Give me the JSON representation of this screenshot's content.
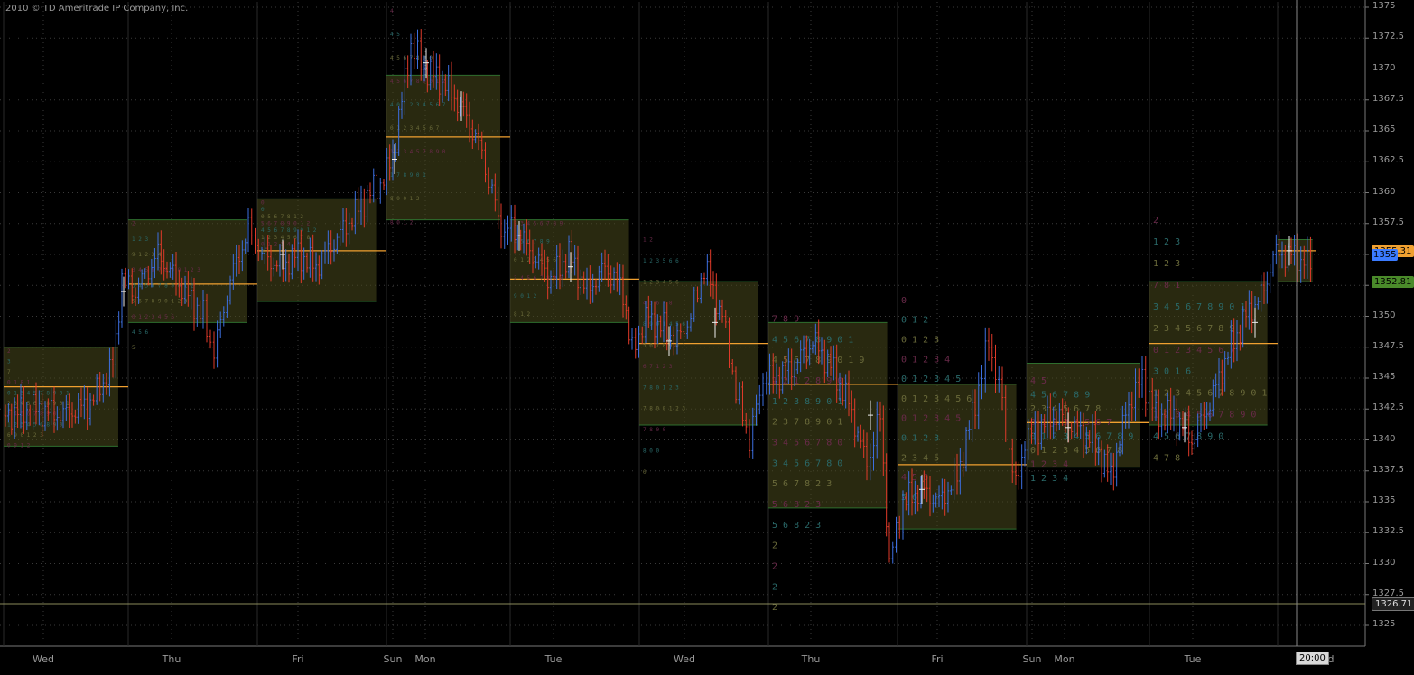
{
  "copyright": "2010 © TD Ameritrade IP Company, Inc.",
  "y_axis": {
    "ticks": [
      "1375",
      "1372.5",
      "1370",
      "1367.5",
      "1365",
      "1362.5",
      "1360",
      "1357.5",
      "1355",
      "1352.5",
      "1350",
      "1347.5",
      "1345",
      "1342.5",
      "1340",
      "1337.5",
      "1335",
      "1332.5",
      "1330",
      "1327.5",
      "1325"
    ]
  },
  "x_axis": {
    "labels": [
      "Wed",
      "Thu",
      "Fri",
      "Sun",
      "Mon",
      "Tue",
      "Wed",
      "Thu",
      "Fri",
      "Sun",
      "Mon",
      "Tue"
    ],
    "time_cursor": "20:00",
    "trailing_label": "d"
  },
  "price_badges": {
    "last": "1355.31",
    "last_short": "1355",
    "level": "1352.81",
    "low_line": "1326.71"
  },
  "colors": {
    "up": "#3d6fe0",
    "down": "#e03a2a",
    "grid": "#3a3a3a",
    "poc": "#f0a030",
    "value_area": "#2e6e2e",
    "profile_fill": "#4a4a1e",
    "badge_last": "#3b7bff",
    "badge_level": "#4a8a2a",
    "text": "#9a9a9a"
  },
  "profiles": [
    {
      "label": "Wed",
      "poc": "1344.5",
      "rows": [
        "2",
        "3",
        "7",
        "0 1 8 1",
        "0 1 3 4 5 7 8 9 0 1",
        "2 3 4 5 6 7 8 9 0 1",
        "3 4 5 6 7 8 9 0",
        "1 2 3 4 5 6 8 9 0",
        "6 9 0 1 2 3",
        "0 9 1 2"
      ]
    },
    {
      "label": "Thu",
      "poc": "1352.5",
      "rows": [
        "2",
        "1 2 3",
        "9 1 2 3 4",
        "3 4 5 6 7 8 9 0 1 2 3",
        "3 4 5 6 7 8 9 0 1 2",
        "5 6 7 8 9 0 1 2 3",
        "0 1 2 3 4 5 6",
        "4 5 6",
        "5"
      ]
    },
    {
      "label": "Fri",
      "poc": "1355.3",
      "rows": [
        "0",
        "0",
        "0 5 6 7 8 1 2",
        "5 6 7 8 9 0 1 2",
        "4 5 6 7 8 9 0 1 2",
        "1 2 3 4 5 6 7 8",
        "0 1 2 3 4",
        "1"
      ]
    },
    {
      "label": "Mon",
      "poc": "1364.5",
      "rows": [
        "4",
        "4 5",
        "4 5 6 7 8 9 0",
        "4 5 6 7 8 9 0 1 2",
        "4 0 1 2 3 4 5 6 7",
        "0 1 2 3 4 5 6 7",
        "1 2 3 4 5 7 8 9 0",
        "1 7 8 9 0 1",
        "8 9 0 1 2",
        "8 0 1 2"
      ]
    },
    {
      "label": "Tue",
      "poc": "1353",
      "rows": [
        "2 3 4 5 6 7 8 9",
        "4 5 6 7 8 9",
        "0 1 2 3 4 5 6",
        "3 4 5 6 7 8 9 0",
        "9 0 1 2",
        "8 1 2"
      ]
    },
    {
      "label": "Wed",
      "poc": "1348",
      "rows": [
        "1 2",
        "1 2 3 5 6 6",
        "1 2 3 4 5 6",
        "4 5 6 7 8",
        "8 9 0 1 4 5 6",
        "5 6 7 8 9 0 1",
        "6 7 1 2 3",
        "7 8 0 1 2 3",
        "7 8 0 0 1 2 3",
        "7 8 0 0",
        "8 0 0",
        "0"
      ]
    },
    {
      "label": "Thu",
      "poc": "1344.5",
      "rows": [
        "7 8 9",
        "4 5 6 7 8 9 0 1",
        "4 5 6 7 8 9 0 1 9",
        "1 2 1 2 8 9 0",
        "1 2 3 8 9 0 1",
        "2 3 7 8 9 0 1",
        "3 4 5 6 7 8 0",
        "3 4 5 6 7 8 0",
        "5 6 7 8 2 3",
        "5 6 8 2 3",
        "5 6 8 2 3",
        "2",
        "2",
        "2",
        "2"
      ]
    },
    {
      "label": "Fri",
      "poc": "1338",
      "rows": [
        "0",
        "0 1 2",
        "0 1 2 3",
        "0 1 2 3 4",
        "0 1 2 3 4 5",
        "0 1 2 3 4 5 6",
        "0 1 2 3 4 5",
        "0 1 2 3",
        "2 3 4 5",
        "4 5 6",
        "5 6"
      ]
    },
    {
      "label": "Mon",
      "poc": "1341.5",
      "rows": [
        "4 5",
        "4 5 6 7 8 9",
        "2 3 4 5 6 7 8",
        "0 1 2 3 4 5 6 7",
        "0 1 2 3 4 5 6 7 8 9",
        "0 1 2 3 4 5 6 7 8",
        "1 2 3 4",
        "1 2 3 4"
      ]
    },
    {
      "label": "Tue",
      "poc": "1348",
      "rows": [
        "2",
        "1 2 3",
        "1 2 3",
        "7 8 1",
        "3 4 5 6 7 8 9 0 1",
        "2 3 4 5 6 7 8 9",
        "0 1 2 3 4 5 6 7",
        "3 0 1 6",
        "1 2 3 4 5 6 7 8 9 0 1",
        "1 2 3 4 5 6 7 8 9 0",
        "4 5 6 7 8 9 0",
        "4 7 8"
      ]
    }
  ]
}
